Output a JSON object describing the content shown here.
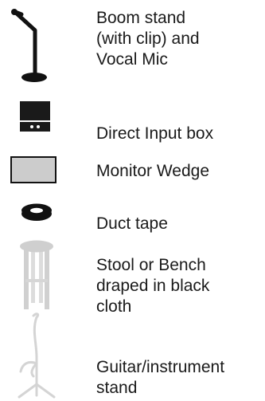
{
  "legend": {
    "items": [
      {
        "label": "Boom stand\n(with clip) and\nVocal Mic",
        "icon": "boom-stand-mic-icon",
        "color": "#111111"
      },
      {
        "label": "Direct Input box",
        "icon": "di-box-icon",
        "color": "#1a1a1a"
      },
      {
        "label": "Monitor Wedge",
        "icon": "monitor-wedge-icon",
        "color": "#cccccc"
      },
      {
        "label": "Duct tape",
        "icon": "duct-tape-icon",
        "color": "#111111"
      },
      {
        "label": "Stool or Bench\ndraped in black\ncloth",
        "icon": "stool-icon",
        "color": "#cfcfcf"
      },
      {
        "label": "Guitar/instrument\nstand",
        "icon": "guitar-stand-icon",
        "color": "#d4d4d4"
      }
    ]
  }
}
